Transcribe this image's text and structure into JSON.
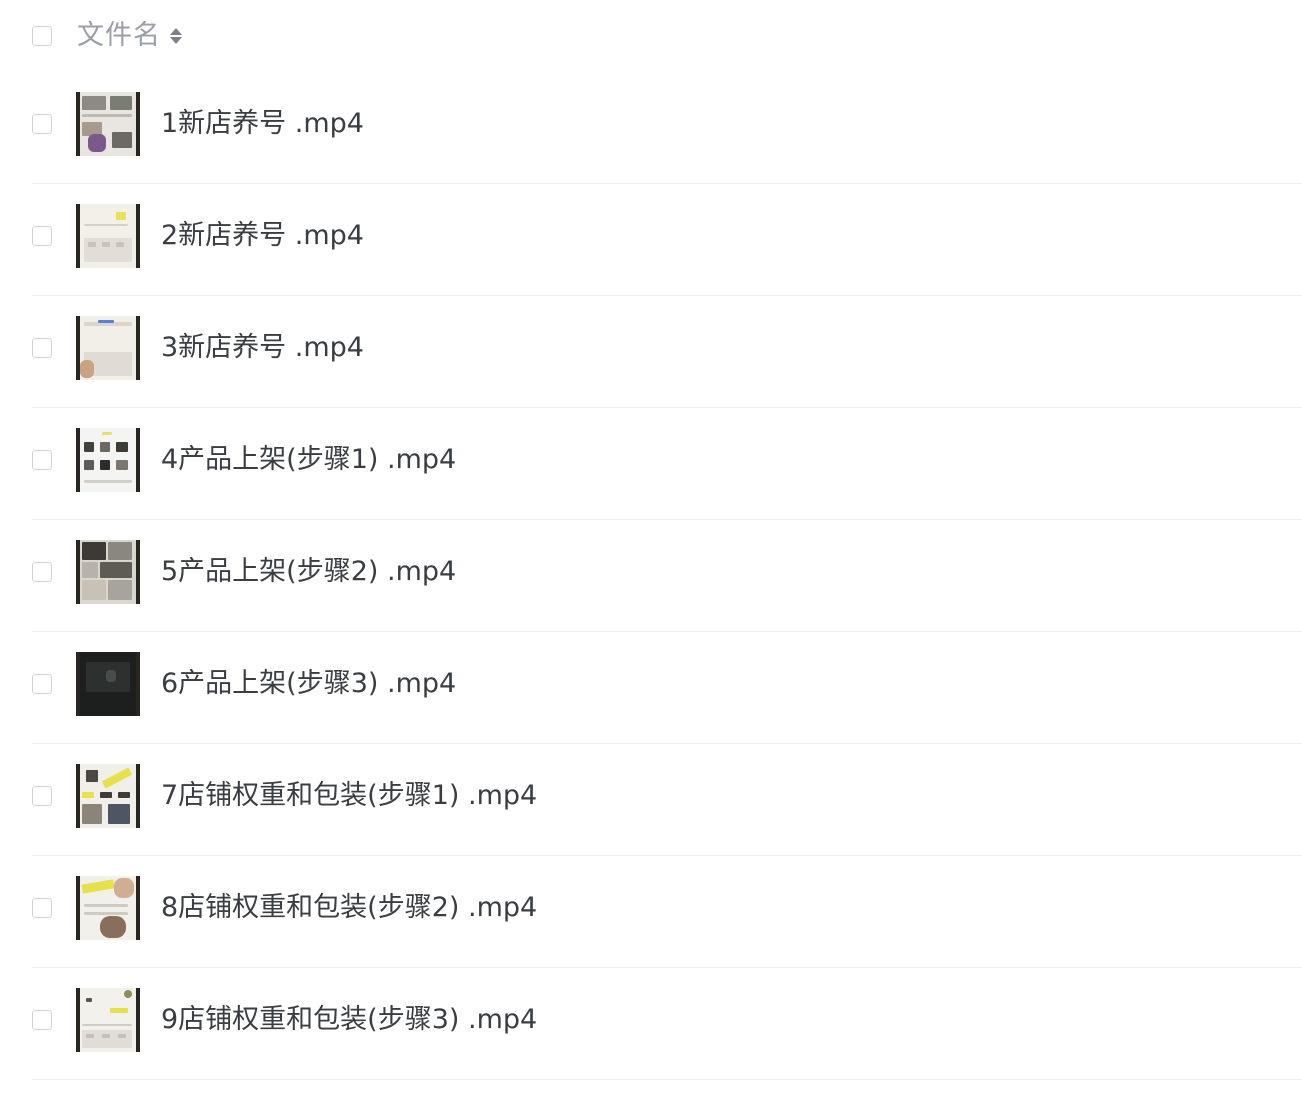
{
  "header": {
    "column_label": "文件名",
    "sort_icon": "sort-icon"
  },
  "files": [
    {
      "name": "1新店养号 .mp4",
      "thumb_icon": "video-thumbnail"
    },
    {
      "name": "2新店养号 .mp4",
      "thumb_icon": "video-thumbnail"
    },
    {
      "name": "3新店养号 .mp4",
      "thumb_icon": "video-thumbnail"
    },
    {
      "name": "4产品上架(步骤1) .mp4",
      "thumb_icon": "video-thumbnail"
    },
    {
      "name": "5产品上架(步骤2) .mp4",
      "thumb_icon": "video-thumbnail"
    },
    {
      "name": "6产品上架(步骤3) .mp4",
      "thumb_icon": "video-thumbnail"
    },
    {
      "name": "7店铺权重和包装(步骤1) .mp4",
      "thumb_icon": "video-thumbnail"
    },
    {
      "name": "8店铺权重和包装(步骤2) .mp4",
      "thumb_icon": "video-thumbnail"
    },
    {
      "name": "9店铺权重和包装(步骤3) .mp4",
      "thumb_icon": "video-thumbnail"
    }
  ],
  "colors": {
    "text": "#3a3d42",
    "header_text": "#9a9ea6",
    "divider": "#eceef1",
    "checkbox_border": "#cfd3d8"
  }
}
